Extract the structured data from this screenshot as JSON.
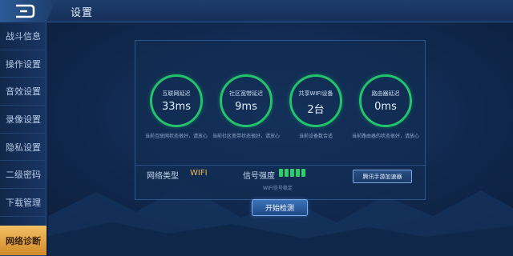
{
  "header": {
    "title": "设置",
    "back_icon": "back-arrow-icon"
  },
  "sidebar": {
    "items": [
      {
        "label": "战斗信息"
      },
      {
        "label": "操作设置"
      },
      {
        "label": "音效设置"
      },
      {
        "label": "录像设置"
      },
      {
        "label": "隐私设置"
      },
      {
        "label": "二级密码"
      },
      {
        "label": "下载管理"
      },
      {
        "label": "网络诊断",
        "active": true
      }
    ]
  },
  "diagnostics": {
    "circles": [
      {
        "label": "互联网延迟",
        "value": "33ms",
        "desc": "当前互联网状态很好，请放心"
      },
      {
        "label": "社区宽带延迟",
        "value": "9ms",
        "desc": "当前社区宽带状态很好，请放心"
      },
      {
        "label": "共享WIFI设备",
        "value": "2台",
        "desc": "当前设备数合适"
      },
      {
        "label": "路由器延迟",
        "value": "0ms",
        "desc": "当前路由器的状态很好，请放心"
      }
    ],
    "network_type_label": "网络类型",
    "network_type_value": "WIFI",
    "signal_label": "信号强度",
    "signal_level": "5/5",
    "signal_note": "WIFI信号稳定",
    "accelerator_button": "腾讯手游加速器",
    "start_button": "开始检测"
  },
  "colors": {
    "accent_green": "#22c36a",
    "active_tab": "#e8a846",
    "value_yellow": "#f0b84a"
  }
}
